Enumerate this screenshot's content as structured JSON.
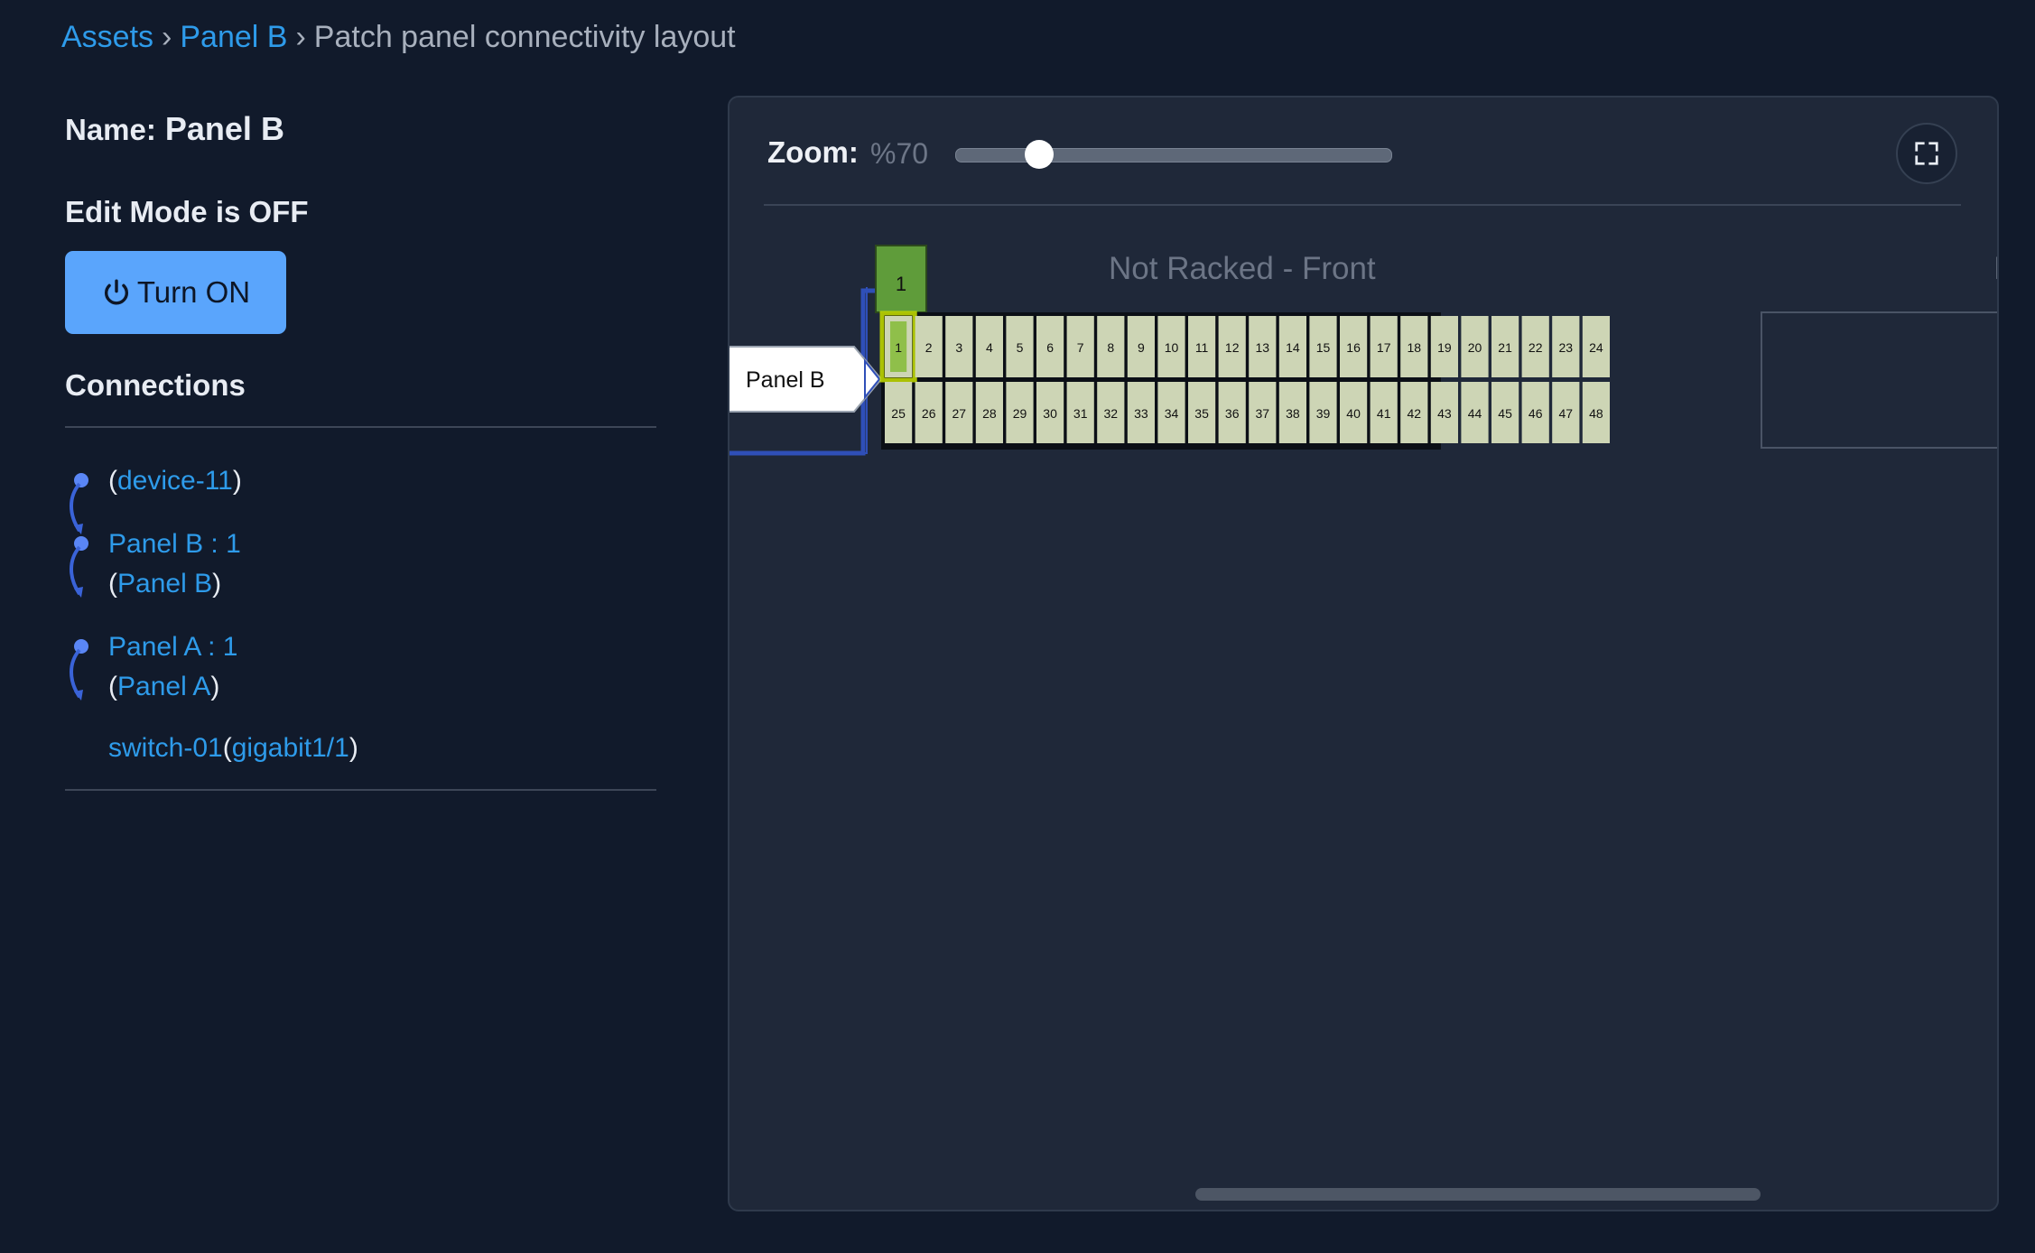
{
  "breadcrumb": {
    "items": [
      {
        "label": "Assets"
      },
      {
        "label": "Panel B"
      }
    ],
    "current": "Patch panel connectivity layout",
    "separator": "›"
  },
  "panel": {
    "name_prefix": "Name:",
    "name": "Panel B",
    "edit_mode_text": "Edit Mode is OFF",
    "turn_on_label": "Turn ON",
    "connections_title": "Connections"
  },
  "connections": {
    "device_1": "device-11",
    "port_2": "Panel B : 1",
    "device_2": "Panel B",
    "port_3": "Panel A : 1",
    "device_3": "Panel A",
    "end_device": "switch-01",
    "end_port": "gigabit1/1"
  },
  "viewer": {
    "zoom_label": "Zoom:",
    "zoom_value": "%70",
    "zoom_fraction": 0.19,
    "rack_title": "Not Racked - Front",
    "clipped_next_label": "I",
    "panel_label": "Panel B",
    "selected_port_tag": "1",
    "ports_per_row": 24,
    "port_rows": 2,
    "selected_port": 1
  },
  "colors": {
    "background": "#111a2b",
    "viewer_bg": "#1f2839",
    "link": "#2e9bea",
    "button": "#5aa5fc",
    "port_fill": "#cdd5b5",
    "port_tag": "#5f9c3a",
    "highlight": "#c8e000",
    "trace_line": "#2f4fb8"
  },
  "icons": {
    "power": "power-icon",
    "fullscreen": "fullscreen-icon",
    "connector": "connector-curve-icon"
  }
}
